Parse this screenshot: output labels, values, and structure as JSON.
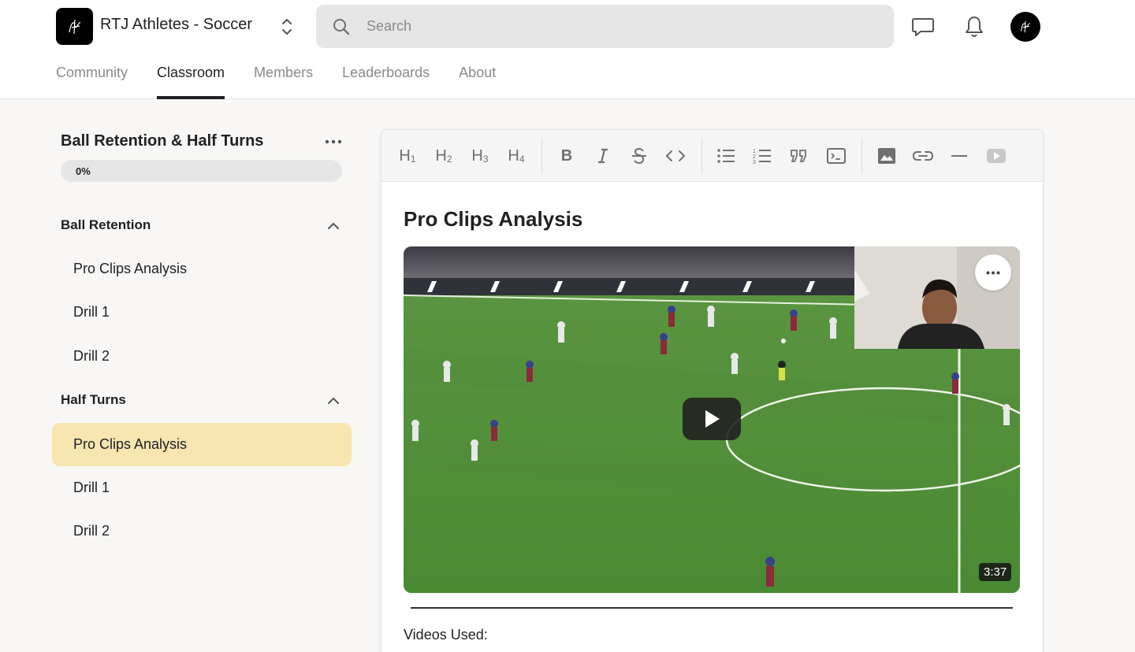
{
  "header": {
    "group_name": "RTJ Athletes - Soccer",
    "search_placeholder": "Search"
  },
  "tabs": [
    {
      "label": "Community",
      "active": false
    },
    {
      "label": "Classroom",
      "active": true
    },
    {
      "label": "Members",
      "active": false
    },
    {
      "label": "Leaderboards",
      "active": false
    },
    {
      "label": "About",
      "active": false
    }
  ],
  "course": {
    "title": "Ball Retention & Half Turns",
    "progress_label": "0%",
    "progress_value": 0
  },
  "sections": [
    {
      "title": "Ball Retention",
      "lessons": [
        "Pro Clips Analysis",
        "Drill 1",
        "Drill 2"
      ]
    },
    {
      "title": "Half Turns",
      "lessons": [
        "Pro Clips Analysis",
        "Drill 1",
        "Drill 2"
      ],
      "active_lesson_index": 0
    }
  ],
  "editor": {
    "toolbar": [
      "H1",
      "H2",
      "H3",
      "H4",
      "bold",
      "italic",
      "strikethrough",
      "code",
      "bullet-list",
      "numbered-list",
      "quote",
      "code-block",
      "image",
      "link",
      "horizontal-rule",
      "video"
    ],
    "lesson_title": "Pro Clips Analysis",
    "video": {
      "duration": "3:37"
    },
    "videos_used_label": "Videos Used:"
  },
  "colors": {
    "active_lesson_bg": "#f8e5b0",
    "search_bg": "#e6e6e6",
    "pitch_green": "#4f8a37"
  }
}
